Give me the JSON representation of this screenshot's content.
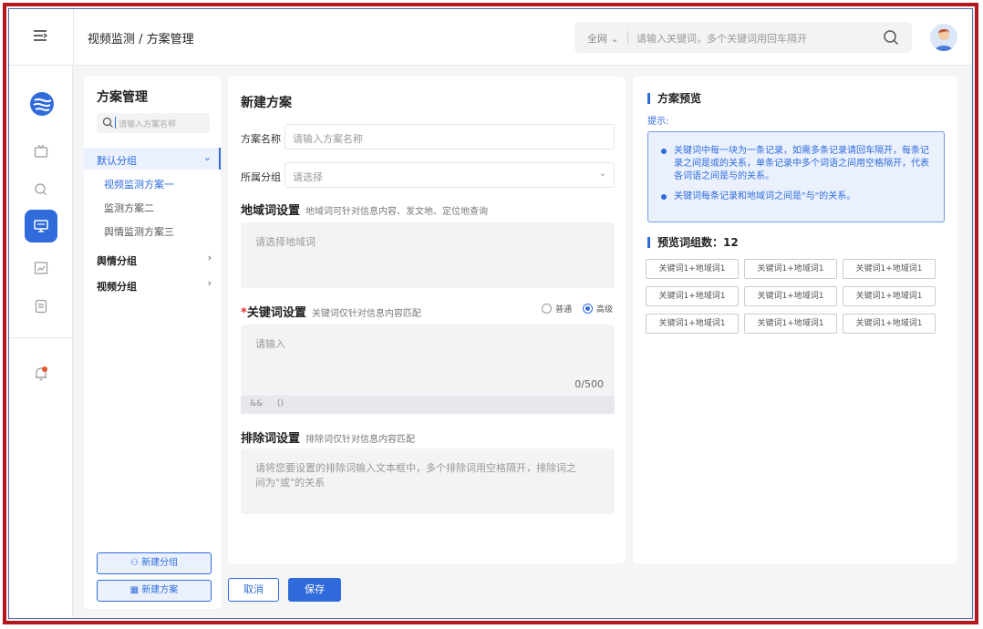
{
  "header": {
    "breadcrumb": "视频监测 / 方案管理",
    "search_scope": "全网 ⌄",
    "search_placeholder": "请输入关键词，多个关键词用回车隔开"
  },
  "list_panel": {
    "title": "方案管理",
    "search_placeholder": "请输入方案名称",
    "groups": [
      {
        "label": "默认分组",
        "arrow": "⌄",
        "plans": [
          "视频监测方案一",
          "监测方案二",
          "舆情监测方案三"
        ]
      },
      {
        "label": "舆情分组",
        "arrow": "›"
      },
      {
        "label": "视频分组",
        "arrow": "›"
      }
    ],
    "new_group_button": "新建分组",
    "new_plan_button": "新建方案"
  },
  "form": {
    "title": "新建方案",
    "name_label": "方案名称",
    "name_placeholder": "请输入方案名称",
    "group_label": "所属分组",
    "group_placeholder": "请选择",
    "region_title": "地域词设置",
    "region_sub": "地域词可针对信息内容、发文地、定位地查询",
    "region_placeholder": "请选择地域词",
    "keyword_required": "*",
    "keyword_title": "关键词设置",
    "keyword_sub": "关键词仅针对信息内容匹配",
    "mode_normal": "普通",
    "mode_advanced": "高级",
    "keyword_placeholder": "请输入",
    "keyword_counter": "0/500",
    "toolbar_and": "&&",
    "toolbar_paren": "()",
    "exclude_title": "排除词设置",
    "exclude_sub": "排除词仅针对信息内容匹配",
    "exclude_placeholder": "请将您要设置的排除词输入文本框中，多个排除词用空格隔开，排除词之间为\"或\"的关系",
    "cancel_button": "取消",
    "save_button": "保存"
  },
  "preview": {
    "title": "方案预览",
    "tip_label": "提示:",
    "tips": [
      "关键词中每一块为一条记录，如需多条记录请回车隔开，每条记录之间是或的关系，单条记录中多个词语之间用空格隔开，代表各词语之间是与的关系。",
      "关键词每条记录和地域词之间是\"与\"的关系。"
    ],
    "count_label": "预览词组数：12",
    "chips": [
      "关键词1+地域词1",
      "关键词1+地域词1",
      "关键词1+地域词1",
      "关键词1+地域词1",
      "关键词1+地域词1",
      "关键词1+地域词1",
      "关键词1+地域词1",
      "关键词1+地域词1",
      "关键词1+地域词1"
    ]
  },
  "colors": {
    "accent": "#2f6bdb",
    "frame": "#b5171e",
    "alert_dot": "#e8542f"
  },
  "rail_icons": [
    "app-logo-icon",
    "tv-icon",
    "search-icon",
    "monitor-icon",
    "chart-icon",
    "document-icon",
    "bell-icon"
  ]
}
